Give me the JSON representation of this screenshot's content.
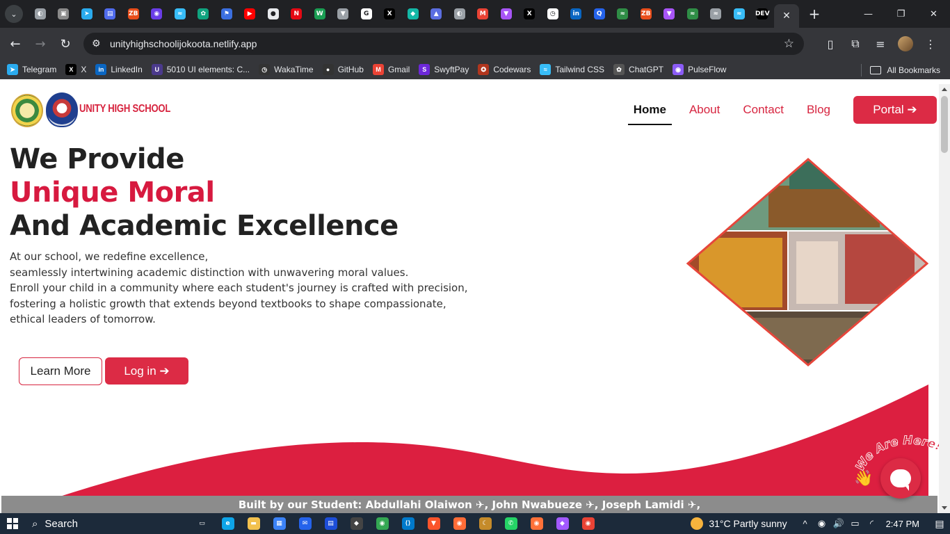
{
  "browser": {
    "url": "unityhighschoolijokoota.netlify.app",
    "tab_favicons": [
      {
        "name": "chrome-icon",
        "color": "#9aa0a6",
        "glyph": "◐"
      },
      {
        "name": "app-icon",
        "color": "#8a8a8a",
        "glyph": "▣"
      },
      {
        "name": "telegram-icon",
        "color": "#2aabee",
        "glyph": "➤"
      },
      {
        "name": "docs-icon",
        "color": "#4f6bed",
        "glyph": "▤"
      },
      {
        "name": "zb-icon",
        "color": "#e94e1b",
        "glyph": "ZB"
      },
      {
        "name": "app-purple-icon",
        "color": "#6a3de8",
        "glyph": "◉"
      },
      {
        "name": "tailwind-icon",
        "color": "#38bdf8",
        "glyph": "≈"
      },
      {
        "name": "chatgpt-icon",
        "color": "#10a37f",
        "glyph": "✿"
      },
      {
        "name": "flag-icon",
        "color": "#3b6fe0",
        "glyph": "⚑"
      },
      {
        "name": "youtube-icon",
        "color": "#ff0000",
        "glyph": "▶"
      },
      {
        "name": "github-icon",
        "color": "#e8eaed",
        "glyph": "●"
      },
      {
        "name": "netflix-icon",
        "color": "#e50914",
        "glyph": "N"
      },
      {
        "name": "wakatime-w-icon",
        "color": "#1a9e53",
        "glyph": "W"
      },
      {
        "name": "vue-icon",
        "color": "#9aa0a6",
        "glyph": "▼"
      },
      {
        "name": "google-icon",
        "color": "#ffffff",
        "glyph": "G"
      },
      {
        "name": "x-icon",
        "color": "#000000",
        "glyph": "X"
      },
      {
        "name": "diamond-icon",
        "color": "#14b8a6",
        "glyph": "◆"
      },
      {
        "name": "account-icon",
        "color": "#5b6ee1",
        "glyph": "▲"
      },
      {
        "name": "globe-icon",
        "color": "#9aa0a6",
        "glyph": "◐"
      },
      {
        "name": "gmail-icon",
        "color": "#ea4335",
        "glyph": "M"
      },
      {
        "name": "vite-icon",
        "color": "#a855f7",
        "glyph": "▼"
      },
      {
        "name": "x-icon",
        "color": "#000000",
        "glyph": "X"
      },
      {
        "name": "clock-icon",
        "color": "#ffffff",
        "glyph": "◷"
      },
      {
        "name": "linkedin-icon",
        "color": "#0a66c2",
        "glyph": "in"
      },
      {
        "name": "search-q-icon",
        "color": "#2563eb",
        "glyph": "Q"
      },
      {
        "name": "geeks-icon",
        "color": "#2f8d46",
        "glyph": "≈"
      },
      {
        "name": "zb-icon",
        "color": "#e94e1b",
        "glyph": "ZB"
      },
      {
        "name": "vite-icon",
        "color": "#a855f7",
        "glyph": "▼"
      },
      {
        "name": "geeks-icon",
        "color": "#2f8d46",
        "glyph": "≈"
      },
      {
        "name": "tailwind-icon",
        "color": "#9aa0a6",
        "glyph": "≈"
      },
      {
        "name": "tailwind-icon",
        "color": "#38bdf8",
        "glyph": "≈"
      },
      {
        "name": "dev-icon",
        "color": "#000000",
        "glyph": "DEV"
      }
    ],
    "bookmarks": [
      {
        "label": "Telegram",
        "icon": "telegram-icon",
        "color": "#2aabee",
        "glyph": "➤"
      },
      {
        "label": "X",
        "icon": "x-icon",
        "color": "#000000",
        "glyph": "X"
      },
      {
        "label": "LinkedIn",
        "icon": "linkedin-icon",
        "color": "#0a66c2",
        "glyph": "in"
      },
      {
        "label": "5010 UI elements: C...",
        "icon": "uiverse-icon",
        "color": "#4b3a8c",
        "glyph": "U"
      },
      {
        "label": "WakaTime",
        "icon": "wakatime-icon",
        "color": "#333333",
        "glyph": "◷"
      },
      {
        "label": "GitHub",
        "icon": "github-icon",
        "color": "#333333",
        "glyph": "●"
      },
      {
        "label": "Gmail",
        "icon": "gmail-icon",
        "color": "#ea4335",
        "glyph": "M"
      },
      {
        "label": "SwyftPay",
        "icon": "swyftpay-icon",
        "color": "#6d28d9",
        "glyph": "S"
      },
      {
        "label": "Codewars",
        "icon": "codewars-icon",
        "color": "#b1361e",
        "glyph": "✪"
      },
      {
        "label": "Tailwind CSS",
        "icon": "tailwind-icon",
        "color": "#38bdf8",
        "glyph": "≈"
      },
      {
        "label": "ChatGPT",
        "icon": "chatgpt-icon",
        "color": "#555555",
        "glyph": "✿"
      },
      {
        "label": "PulseFlow",
        "icon": "pulseflow-icon",
        "color": "#8b5cf6",
        "glyph": "◉"
      }
    ],
    "all_bookmarks": "All Bookmarks"
  },
  "site": {
    "brand": "UNITY HIGH SCHOOL",
    "nav": {
      "home": "Home",
      "about": "About",
      "contact": "Contact",
      "blog": "Blog",
      "portal": "Portal ➔"
    },
    "hero": {
      "line1": "We Provide",
      "line2": "Unique Moral",
      "line3": "And Academic Excellence",
      "p1": "At our school, we redefine excellence,",
      "p2": "seamlessly intertwining academic distinction with unwavering moral values.",
      "p3": "Enroll your child in a community where each student's journey is crafted with precision,",
      "p4": "fostering a holistic growth that extends beyond textbooks to shape compassionate,",
      "p5": "ethical leaders of tomorrow.",
      "learn_more": "Learn More",
      "login": "Log in ➔"
    },
    "built_by": "Built by our Student: Abdullahi Olaiwon ✈, John Nwabueze ✈, Joseph Lamidi ✈,",
    "chat_badge": "We Are Here!",
    "accent_color": "#dc2b45"
  },
  "taskbar": {
    "search_label": "Search",
    "weather": "31°C  Partly sunny",
    "time": "2:47 PM",
    "apps": [
      {
        "name": "task-view-icon",
        "color": "#1c2a3a",
        "glyph": "▭"
      },
      {
        "name": "edge-icon",
        "color": "#0ea5e9",
        "glyph": "e"
      },
      {
        "name": "file-explorer-icon",
        "color": "#f2c14e",
        "glyph": "▬"
      },
      {
        "name": "store-icon",
        "color": "#3b82f6",
        "glyph": "▦"
      },
      {
        "name": "mail-icon",
        "color": "#2563eb",
        "glyph": "✉"
      },
      {
        "name": "docs-app-icon",
        "color": "#1d4ed8",
        "glyph": "▤"
      },
      {
        "name": "git-icon",
        "color": "#444444",
        "glyph": "◆"
      },
      {
        "name": "chrome-icon",
        "color": "#34a853",
        "glyph": "◉"
      },
      {
        "name": "vscode-icon",
        "color": "#007acc",
        "glyph": "⟨⟩"
      },
      {
        "name": "brave-icon",
        "color": "#fb542b",
        "glyph": "▼"
      },
      {
        "name": "postman-icon",
        "color": "#ff6c37",
        "glyph": "◉"
      },
      {
        "name": "genie-icon",
        "color": "#c58b2a",
        "glyph": "☾"
      },
      {
        "name": "whatsapp-icon",
        "color": "#25d366",
        "glyph": "✆"
      },
      {
        "name": "firefox-icon",
        "color": "#ff7139",
        "glyph": "◉"
      },
      {
        "name": "figma-icon",
        "color": "#a259ff",
        "glyph": "◆"
      },
      {
        "name": "chrome-alt-icon",
        "color": "#ea4335",
        "glyph": "◉"
      }
    ]
  }
}
